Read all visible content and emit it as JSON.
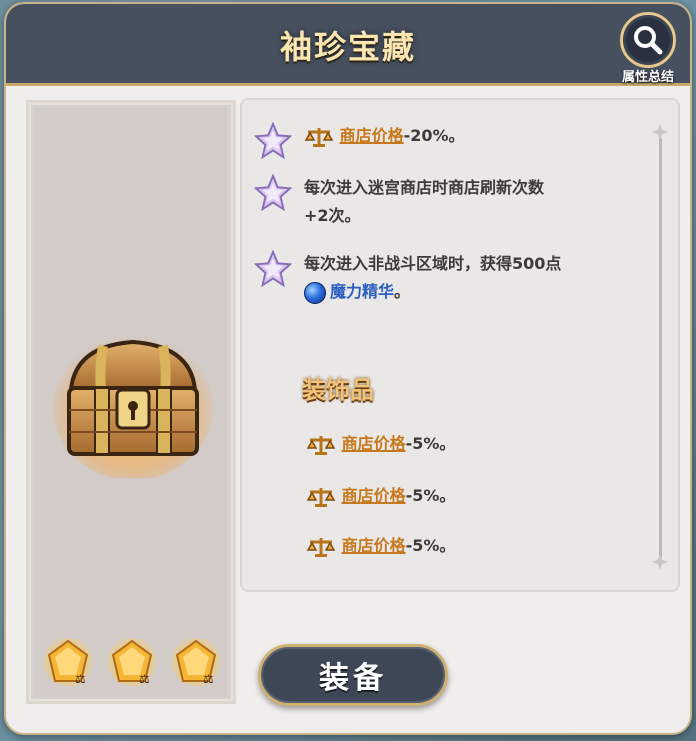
{
  "title": "袖珍宝藏",
  "summary_label": "属性总结",
  "effects": [
    {
      "link": "商店价格",
      "suffix": "-20%。"
    },
    {
      "line1": "每次进入迷宫商店时商店刷新次数",
      "line2": "+2次。"
    },
    {
      "line1": "每次进入非战斗区域时，获得500点",
      "link": "魔力精华",
      "suffix": "。"
    }
  ],
  "accessory_title": "装饰品",
  "accessories": [
    {
      "link": "商店价格",
      "suffix": "-5%。"
    },
    {
      "link": "商店价格",
      "suffix": "-5%。"
    },
    {
      "link": "商店价格",
      "suffix": "-5%。"
    }
  ],
  "equip_label": "装备",
  "colors": {
    "header": "#46505f",
    "gold_border": "#c6a96a",
    "link_orange": "#c8781c",
    "link_blue": "#2a5ec2",
    "section_title": "#f3c27b"
  },
  "icons": {
    "header_button": "magnifier-icon",
    "effect_bullet": "star-icon",
    "price": "scale-icon",
    "essence": "mana-orb-icon",
    "item": "treasure-chest-icon",
    "slot": "gold-gem-icon"
  }
}
